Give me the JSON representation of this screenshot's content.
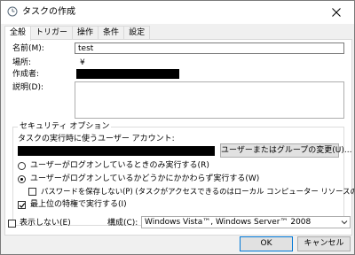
{
  "window": {
    "title": "タスクの作成",
    "close_glyph": "✕"
  },
  "tabs": [
    {
      "label": "全般",
      "active": true
    },
    {
      "label": "トリガー",
      "active": false
    },
    {
      "label": "操作",
      "active": false
    },
    {
      "label": "条件",
      "active": false
    },
    {
      "label": "設定",
      "active": false
    }
  ],
  "general": {
    "name_label": "名前(M):",
    "name_value": "test",
    "location_label": "場所:",
    "location_value": "¥",
    "author_label": "作成者:",
    "description_label": "説明(D):"
  },
  "security": {
    "group_title": "セキュリティ オプション",
    "account_prompt": "タスクの実行時に使うユーザー アカウント:",
    "change_user_button": "ユーザーまたはグループの変更(U)...",
    "run_only_logged_on": "ユーザーがログオンしているときのみ実行する(R)",
    "run_whether_logged_on": "ユーザーがログオンしているかどうかにかかわらず実行する(W)",
    "run_whether_selected": true,
    "no_store_password": "パスワードを保存しない(P) (タスクがアクセスできるのはローカル コンピューター リソースのみ)",
    "no_store_password_checked": false,
    "highest_privileges": "最上位の特権で実行する(I)",
    "highest_privileges_checked": true
  },
  "footer": {
    "hidden_label": "表示しない(E)",
    "hidden_checked": false,
    "configure_label": "構成(C):",
    "configure_value": "Windows Vista™, Windows Server™ 2008",
    "ok_button": "OK",
    "cancel_button": "キャンセル"
  }
}
